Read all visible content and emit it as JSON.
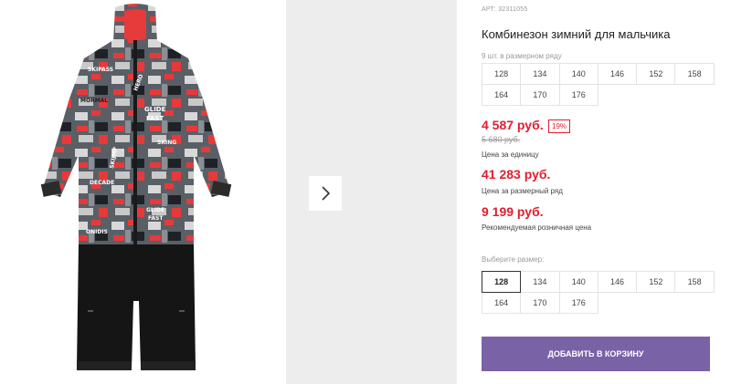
{
  "product": {
    "article": "АРТ: 32311055",
    "title": "Комбинезон зимний для мальчика",
    "pack_note": "9 шт. в размерном ряду",
    "pack_sizes": [
      "128",
      "134",
      "140",
      "146",
      "152",
      "158",
      "164",
      "170",
      "176"
    ],
    "price_unit": "4 587 руб.",
    "discount": "19%",
    "old_price": "5 680 руб.",
    "price_unit_caption": "Цена за единицу",
    "price_range": "41 283 руб.",
    "price_range_caption": "Цена за размерный ряд",
    "price_retail": "9 199 руб.",
    "price_retail_caption": "Рекомендуемая розничная цена",
    "choose_size_label": "Выберите размер:",
    "choose_sizes": [
      "128",
      "134",
      "140",
      "146",
      "152",
      "158",
      "164",
      "170",
      "176"
    ],
    "selected_size": "128",
    "add_to_cart": "ДОБАВИТЬ В КОРЗИНУ"
  },
  "gallery": {
    "next_icon": "chevron-right-icon",
    "photo_labels": [
      "SKIPASS",
      "GLIDE",
      "FAST",
      "MORMAL",
      "HERO",
      "SKING",
      "DECADE",
      "ONIDIS",
      "SKIJMP",
      "GLIDE",
      "FAST"
    ]
  },
  "colors": {
    "accent": "#e01e2e",
    "button": "#7a62a6",
    "muted": "#9a9a9a"
  }
}
